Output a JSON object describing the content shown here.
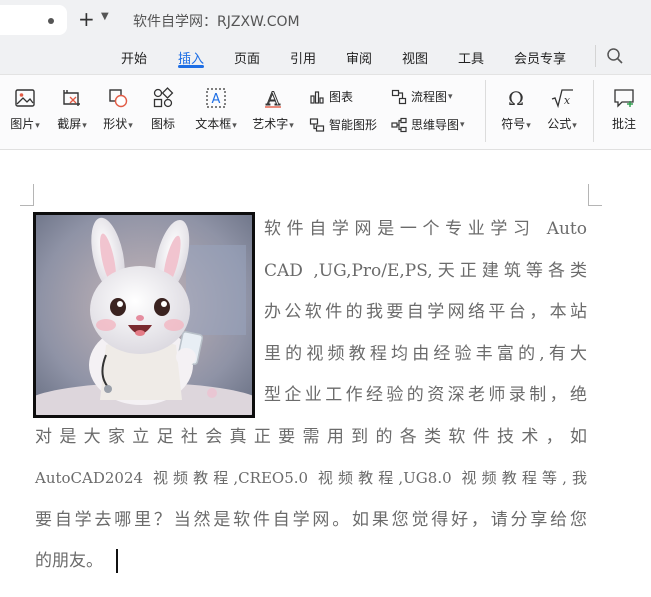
{
  "titlebar": {
    "new_tab_symbol": "+",
    "caret": "⌄",
    "site_title": "软件自学网：RJZXW.COM"
  },
  "menu": {
    "items": [
      "开始",
      "插入",
      "页面",
      "引用",
      "审阅",
      "视图",
      "工具",
      "会员专享"
    ],
    "active": "插入",
    "accent_color": "#1f6fe5"
  },
  "toolbar": {
    "picture": "图片",
    "screenshot": "截屏",
    "shape": "形状",
    "icon": "图标",
    "textbox": "文本框",
    "wordart": "艺术字",
    "chart": "图表",
    "smartart": "智能图形",
    "flowchart": "流程图",
    "mindmap": "思维导图",
    "symbol": "符号",
    "formula": "公式",
    "comment": "批注"
  },
  "document": {
    "picture_description_icon": "cartoon-rabbit-image",
    "lines": [
      "软件自学网是一个专业学习 Auto",
      "CAD ,UG,Pro/E,PS,天正建筑等各类",
      "办公软件的我要自学网络平台，本站",
      "里的视频教程均由经验丰富的,有大",
      "型企业工作经验的资深老师录制，绝",
      "对是大家立足社会真正要需用到的各类软件技术，如",
      "AutoCAD2024 视频教程,CREO5.0 视频教程,UG8.0 视频教程等,我",
      "要自学去哪里？当然是软件自学网。如果您觉得好，请分享给您",
      "的朋友。"
    ]
  }
}
